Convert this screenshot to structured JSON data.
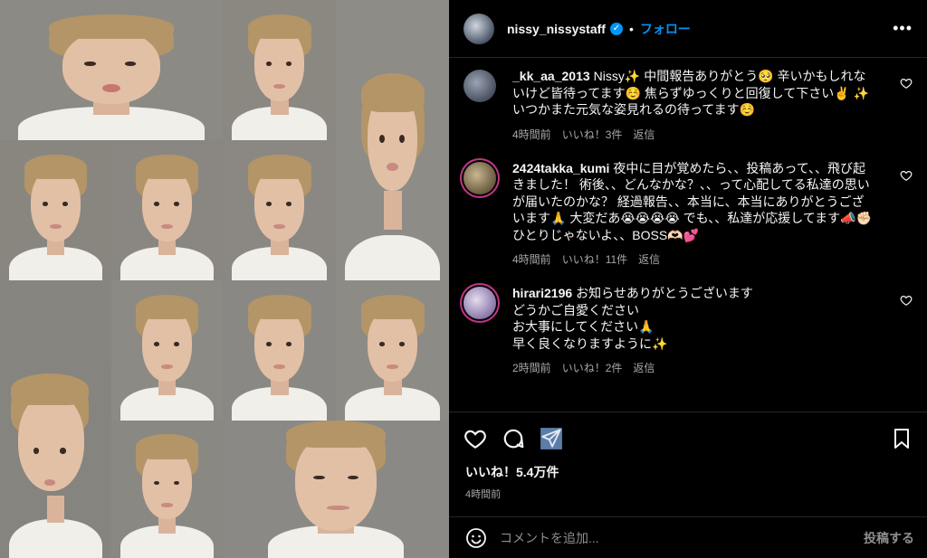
{
  "header": {
    "username": "nissy_nissystaff",
    "separator": "•",
    "follow_label": "フォロー",
    "more_label": "•••"
  },
  "comments": [
    {
      "username": "_kk_aa_2013",
      "text": "Nissy✨ 中間報告ありがとう🥺 辛いかもしれないけど皆待ってます☺️ 焦らずゆっくりと回復して下さい✌️ ✨ いつかまた元気な姿見れるの待ってます☺️",
      "time": "4時間前",
      "likes": "いいね！3件",
      "reply": "返信",
      "avatar_color": "#6a7280"
    },
    {
      "username": "2424takka_kumi",
      "text": "夜中に目が覚めたら、、投稿あって、、飛び起きました！ 術後、、どんなかな？、、って心配してる私達の思いが届いたのかな？ 経過報告、、本当に、本当にありがとうございます🙏 大変だあ😭😭😭😭 でも、、私達が応援してます📣✊🏻 ひとりじゃないよ、、BOSS🫶🏻💕",
      "time": "4時間前",
      "likes": "いいね！11件",
      "reply": "返信",
      "avatar_color": "#8a7a60"
    },
    {
      "username": "hirari2196",
      "text": "お知らせありがとうございます\nどうかご自愛ください\nお大事にしてください🙏\n早く良くなりますように✨",
      "time": "2時間前",
      "likes": "いいね！2件",
      "reply": "返信",
      "avatar_color": "#b0a0c0"
    }
  ],
  "footer": {
    "like_count": "いいね！5.4万件",
    "post_time": "4時間前",
    "comment_placeholder": "コメントを追加...",
    "post_label": "投稿する"
  },
  "colors": {
    "accent": "#0095f6",
    "background": "#000000",
    "muted_text": "#a8a8a8"
  },
  "icons": [
    "heart-icon",
    "comment-icon",
    "share-icon",
    "bookmark-icon",
    "emoji-icon",
    "verified-badge-icon",
    "more-icon"
  ]
}
